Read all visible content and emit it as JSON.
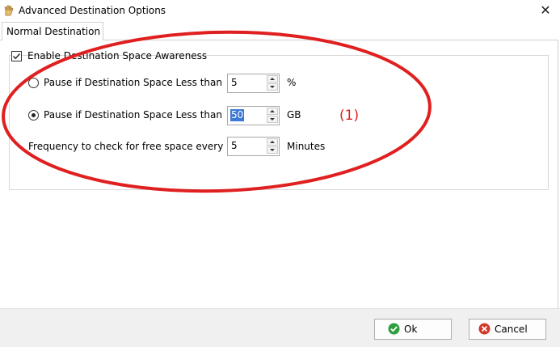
{
  "window": {
    "title": "Advanced Destination Options",
    "close_glyph": "✕",
    "app_icon": "app-hand-icon"
  },
  "tabs": [
    {
      "label": "Normal Destination",
      "active": true
    }
  ],
  "group": {
    "checkbox_checked": true,
    "label": "Enable Destination Space Awareness"
  },
  "options": {
    "percent_row": {
      "radio_selected": false,
      "label": "Pause if Destination Space Less than",
      "value": "5",
      "unit": "%"
    },
    "gb_row": {
      "radio_selected": true,
      "label": "Pause if Destination Space Less than",
      "value": "50",
      "unit": "GB"
    },
    "frequency_row": {
      "label": "Frequency to check for free space every",
      "value": "5",
      "unit": "Minutes"
    }
  },
  "annotation": {
    "label": "(1)",
    "color": "#e02020"
  },
  "buttons": {
    "ok": {
      "label": "Ok",
      "icon": "check-circle-icon",
      "color": "#2e9e3e"
    },
    "cancel": {
      "label": "Cancel",
      "icon": "x-circle-icon",
      "color": "#d23a2a"
    }
  }
}
